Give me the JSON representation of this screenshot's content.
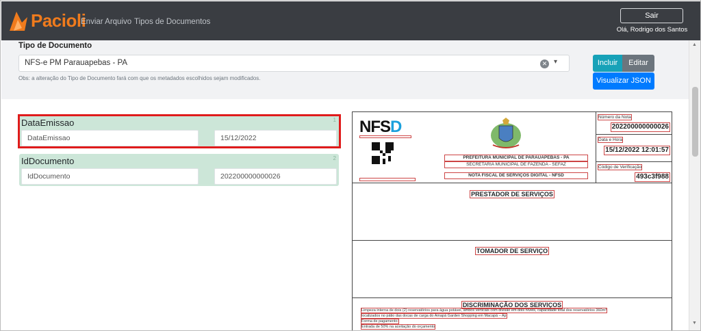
{
  "app": {
    "brand": "Pacioli",
    "nav": [
      {
        "label": "Enviar Arquivo"
      },
      {
        "label": "Tipos de Documentos"
      }
    ],
    "logout_label": "Sair",
    "user_greeting": "Olá, Rodrigo dos Santos"
  },
  "doc_type": {
    "label": "Tipo de Documento",
    "selected": "NFS-e PM Parauapebas - PA",
    "warning": "Obs: a alteração do Tipo de Documento fará com que os metadados escolhidos sejam modificados.",
    "incluir_label": "Incluir",
    "editar_label": "Editar",
    "json_label": "Visualizar JSON"
  },
  "metadata": [
    {
      "title": "DataEmissao",
      "index": "1",
      "field": "DataEmissao",
      "value": "15/12/2022"
    },
    {
      "title": "IdDocumento",
      "index": "2",
      "field": "IdDocumento",
      "value": "202200000000026"
    }
  ],
  "nfse": {
    "logo": "NFS",
    "logo_accent": "D",
    "prefeitura": "PREFEITURA MUNICIPAL DE PARAUAPEBAS - PA",
    "secretaria": "SECRETARIA MUNICIPAL DE FAZENDA - SEFAZ",
    "titulo": "NOTA FISCAL DE SERVIÇOS DIGITAL - NFSD",
    "numero_label": "Número da Nota",
    "numero": "202200000000026",
    "data_label": "Data e Hora",
    "data": "15/12/2022 12:01:57",
    "codigo_label": "Código de Verificação",
    "codigo": "493c3f988",
    "prestador": "PRESTADOR DE SERVIÇOS",
    "tomador": "TOMADOR DE SERVIÇO",
    "discriminacao": "DISCRIMINAÇÃO DOS SERVIÇOS",
    "disc_lines": [
      "Limpeza interna de dois (2) reservatórios para água potável, ambos verticais com divisão em dois níveis, capacidade total dos reservatórios 360m³",
      "localizados no pátio das docas de carga do Amapá Garden Shopping em Macapá – Ap",
      "Forma de pagamento:",
      "Entrada de 50% na aceitação do orçamento"
    ]
  },
  "colors": {
    "navbar": "#3a3d42",
    "brand_orange": "#f07b1d",
    "card_green": "#cce6d8",
    "btn_incluir": "#17a2b8",
    "btn_editar": "#6c757d",
    "btn_json": "#007bff",
    "highlight": "#e01b1b"
  }
}
